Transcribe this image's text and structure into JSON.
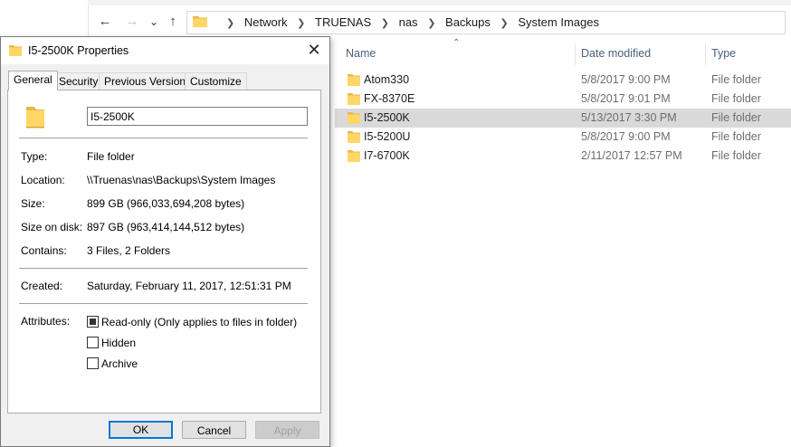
{
  "explorer": {
    "nav": {
      "back": "←",
      "forward": "→",
      "recent": "⌄",
      "up": "↑"
    },
    "breadcrumbs": [
      "Network",
      "TRUENAS",
      "nas",
      "Backups",
      "System Images"
    ],
    "columns": {
      "name": "Name",
      "date": "Date modified",
      "type": "Type"
    },
    "files": [
      {
        "name": "Atom330",
        "date": "5/8/2017 9:00 PM",
        "type": "File folder"
      },
      {
        "name": "FX-8370E",
        "date": "5/8/2017 9:01 PM",
        "type": "File folder"
      },
      {
        "name": "I5-2500K",
        "date": "5/13/2017 3:30 PM",
        "type": "File folder"
      },
      {
        "name": "I5-5200U",
        "date": "5/8/2017 9:00 PM",
        "type": "File folder"
      },
      {
        "name": "I7-6700K",
        "date": "2/11/2017 12:57 PM",
        "type": "File folder"
      }
    ]
  },
  "dialog": {
    "title": "I5-2500K Properties",
    "close": "✕",
    "tabs": [
      "General",
      "Security",
      "Previous Versions",
      "Customize"
    ],
    "name_value": "I5-2500K",
    "labels": {
      "type": "Type:",
      "location": "Location:",
      "size": "Size:",
      "size_on_disk": "Size on disk:",
      "contains": "Contains:",
      "created": "Created:",
      "attributes": "Attributes:"
    },
    "values": {
      "type": "File folder",
      "location": "\\\\Truenas\\nas\\Backups\\System Images",
      "size": "899 GB (966,033,694,208 bytes)",
      "size_on_disk": "897 GB (963,414,144,512 bytes)",
      "contains": "3 Files, 2 Folders",
      "created": "Saturday, February 11, 2017, 12:51:31 PM"
    },
    "attributes": {
      "readonly": "Read-only (Only applies to files in folder)",
      "hidden": "Hidden",
      "archive": "Archive"
    },
    "buttons": {
      "ok": "OK",
      "cancel": "Cancel",
      "apply": "Apply"
    }
  },
  "colors": {
    "folder": "#ffd766",
    "folder_dark": "#e8b84a",
    "accent": "#0078d7",
    "selection": "#d9d9d9"
  }
}
